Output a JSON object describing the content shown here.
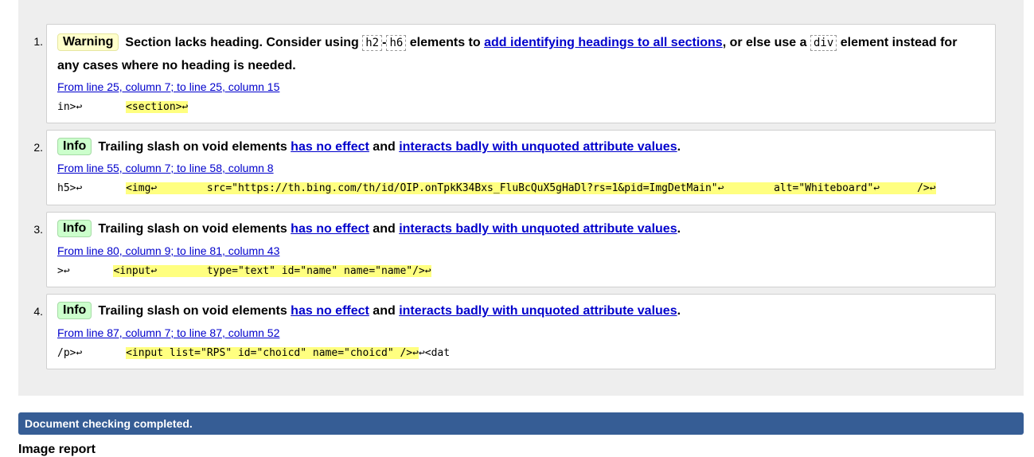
{
  "messages": [
    {
      "number": "1.",
      "type": "Warning",
      "text_a": "Section lacks heading. Consider using ",
      "code_a": "h2",
      "dash": "-",
      "code_b": "h6",
      "text_b": " elements to ",
      "link_a": "add identifying headings to all sections",
      "text_c": ", or else use a ",
      "code_c": "div",
      "text_d": " element instead for",
      "line2": "any cases where no heading is needed.",
      "location": "From line 25, column 7; to line 25, column 15",
      "extract_pre": "in>↩       ",
      "extract_hl": "<section>↩",
      "extract_post": ""
    },
    {
      "number": "2.",
      "type": "Info",
      "text_a": "Trailing slash on void elements ",
      "link_a": "has no effect",
      "text_b": " and ",
      "link_b": "interacts badly with unquoted attribute values",
      "text_c": ".",
      "location": "From line 55, column 7; to line 58, column 8",
      "extract_pre": "h5>↩       ",
      "extract_hl": "<img↩        src=\"https://th.bing.com/th/id/OIP.onTpkK34Bxs_FluBcQuX5gHaDl?rs=1&pid=ImgDetMain\"↩        alt=\"Whiteboard\"↩      />↩",
      "extract_post": ""
    },
    {
      "number": "3.",
      "type": "Info",
      "text_a": "Trailing slash on void elements ",
      "link_a": "has no effect",
      "text_b": " and ",
      "link_b": "interacts badly with unquoted attribute values",
      "text_c": ".",
      "location": "From line 80, column 9; to line 81, column 43",
      "extract_pre": ">↩       ",
      "extract_hl": "<input↩        type=\"text\" id=\"name\" name=\"name\"/>↩",
      "extract_post": ""
    },
    {
      "number": "4.",
      "type": "Info",
      "text_a": "Trailing slash on void elements ",
      "link_a": "has no effect",
      "text_b": " and ",
      "link_b": "interacts badly with unquoted attribute values",
      "text_c": ".",
      "location": "From line 87, column 7; to line 87, column 52",
      "extract_pre": "/p>↩       ",
      "extract_hl": "<input list=\"RPS\" id=\"choicd\" name=\"choicd\" />↩",
      "extract_post": "↩<dat"
    }
  ],
  "status": {
    "text": "Document checking completed."
  },
  "image_report": {
    "heading": "Image report"
  },
  "colors": {
    "panel_bg": "#eeeeee",
    "warning_badge": "#ffffcc",
    "info_badge": "#ccffcc",
    "highlight": "#ffff80",
    "link": "#0000cc",
    "status_bar": "#365d95"
  }
}
